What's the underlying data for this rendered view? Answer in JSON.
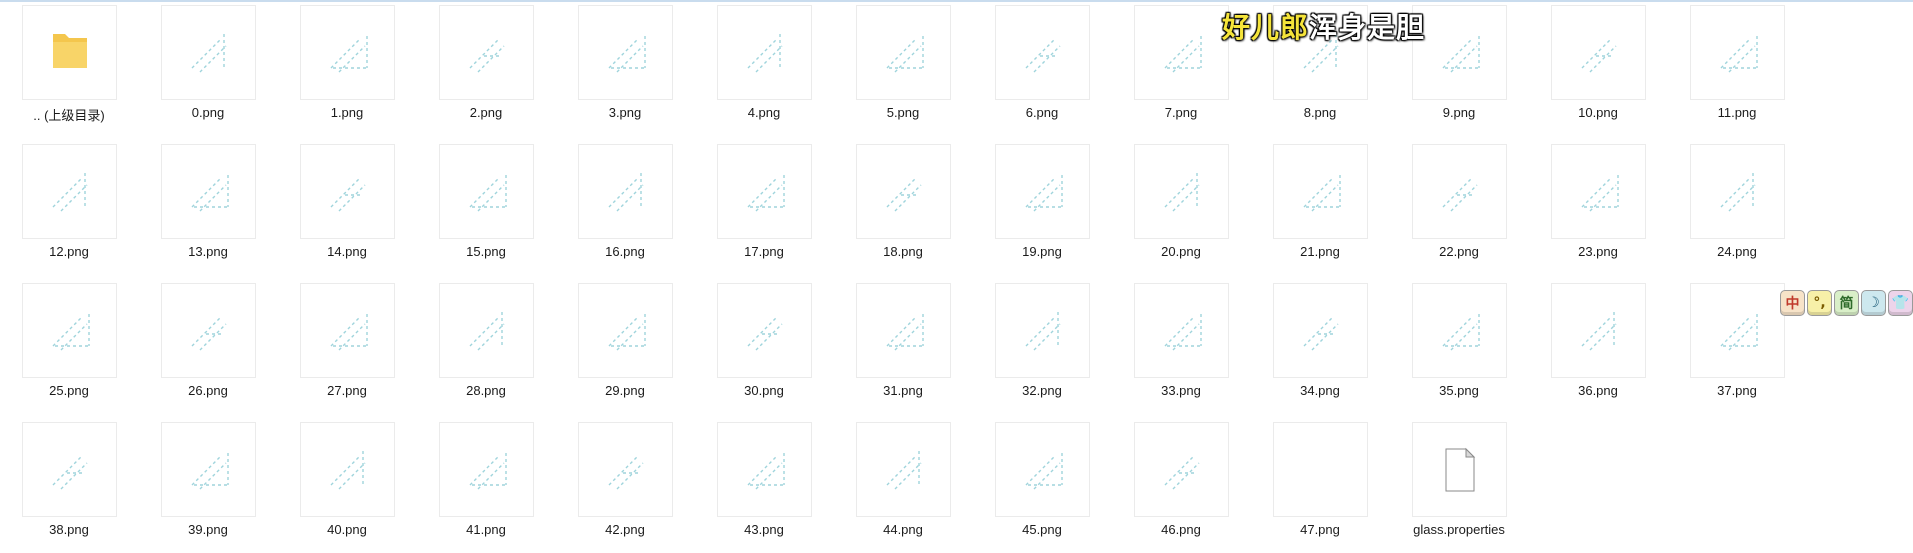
{
  "window": {
    "accent": "#c9dcee"
  },
  "files": [
    {
      "name": ".. (上级目录)",
      "type": "folder"
    },
    {
      "name": "0.png",
      "type": "png"
    },
    {
      "name": "1.png",
      "type": "png"
    },
    {
      "name": "2.png",
      "type": "png"
    },
    {
      "name": "3.png",
      "type": "png"
    },
    {
      "name": "4.png",
      "type": "png"
    },
    {
      "name": "5.png",
      "type": "png"
    },
    {
      "name": "6.png",
      "type": "png"
    },
    {
      "name": "7.png",
      "type": "png"
    },
    {
      "name": "8.png",
      "type": "png"
    },
    {
      "name": "9.png",
      "type": "png"
    },
    {
      "name": "10.png",
      "type": "png"
    },
    {
      "name": "11.png",
      "type": "png"
    },
    {
      "name": "12.png",
      "type": "png"
    },
    {
      "name": "13.png",
      "type": "png"
    },
    {
      "name": "14.png",
      "type": "png"
    },
    {
      "name": "15.png",
      "type": "png"
    },
    {
      "name": "16.png",
      "type": "png"
    },
    {
      "name": "17.png",
      "type": "png"
    },
    {
      "name": "18.png",
      "type": "png"
    },
    {
      "name": "19.png",
      "type": "png"
    },
    {
      "name": "20.png",
      "type": "png"
    },
    {
      "name": "21.png",
      "type": "png"
    },
    {
      "name": "22.png",
      "type": "png"
    },
    {
      "name": "23.png",
      "type": "png"
    },
    {
      "name": "24.png",
      "type": "png"
    },
    {
      "name": "25.png",
      "type": "png"
    },
    {
      "name": "26.png",
      "type": "png"
    },
    {
      "name": "27.png",
      "type": "png"
    },
    {
      "name": "28.png",
      "type": "png"
    },
    {
      "name": "29.png",
      "type": "png"
    },
    {
      "name": "30.png",
      "type": "png"
    },
    {
      "name": "31.png",
      "type": "png"
    },
    {
      "name": "32.png",
      "type": "png"
    },
    {
      "name": "33.png",
      "type": "png"
    },
    {
      "name": "34.png",
      "type": "png"
    },
    {
      "name": "35.png",
      "type": "png"
    },
    {
      "name": "36.png",
      "type": "png"
    },
    {
      "name": "37.png",
      "type": "png"
    },
    {
      "name": "38.png",
      "type": "png"
    },
    {
      "name": "39.png",
      "type": "png"
    },
    {
      "name": "40.png",
      "type": "png"
    },
    {
      "name": "41.png",
      "type": "png"
    },
    {
      "name": "42.png",
      "type": "png"
    },
    {
      "name": "43.png",
      "type": "png"
    },
    {
      "name": "44.png",
      "type": "png"
    },
    {
      "name": "45.png",
      "type": "png"
    },
    {
      "name": "46.png",
      "type": "png"
    },
    {
      "name": "47.png",
      "type": "blank"
    },
    {
      "name": "glass.properties",
      "type": "document"
    }
  ],
  "overlay": {
    "part_a": "好儿郎",
    "part_b": "浑身是胆"
  },
  "ime": [
    {
      "label": "中",
      "icon": "chinese-mode-icon",
      "color": "#c0392b",
      "bg": "#f7e3c8"
    },
    {
      "label": "°,",
      "icon": "punctuation-icon",
      "color": "#7a5b00",
      "bg": "#f7f0a8"
    },
    {
      "label": "简",
      "icon": "simplified-icon",
      "color": "#2e6b2a",
      "bg": "#d9efc8"
    },
    {
      "label": "☽",
      "icon": "moon-icon",
      "color": "#1f5f7a",
      "bg": "#cde8ee"
    },
    {
      "label": "👕",
      "icon": "skin-icon",
      "color": "#7a2a6b",
      "bg": "#edd4ea"
    }
  ],
  "colors": {
    "thumb_line": "#9fd4dc",
    "folder": "#f4c64d",
    "doc_fold": "#d9d9d9"
  }
}
